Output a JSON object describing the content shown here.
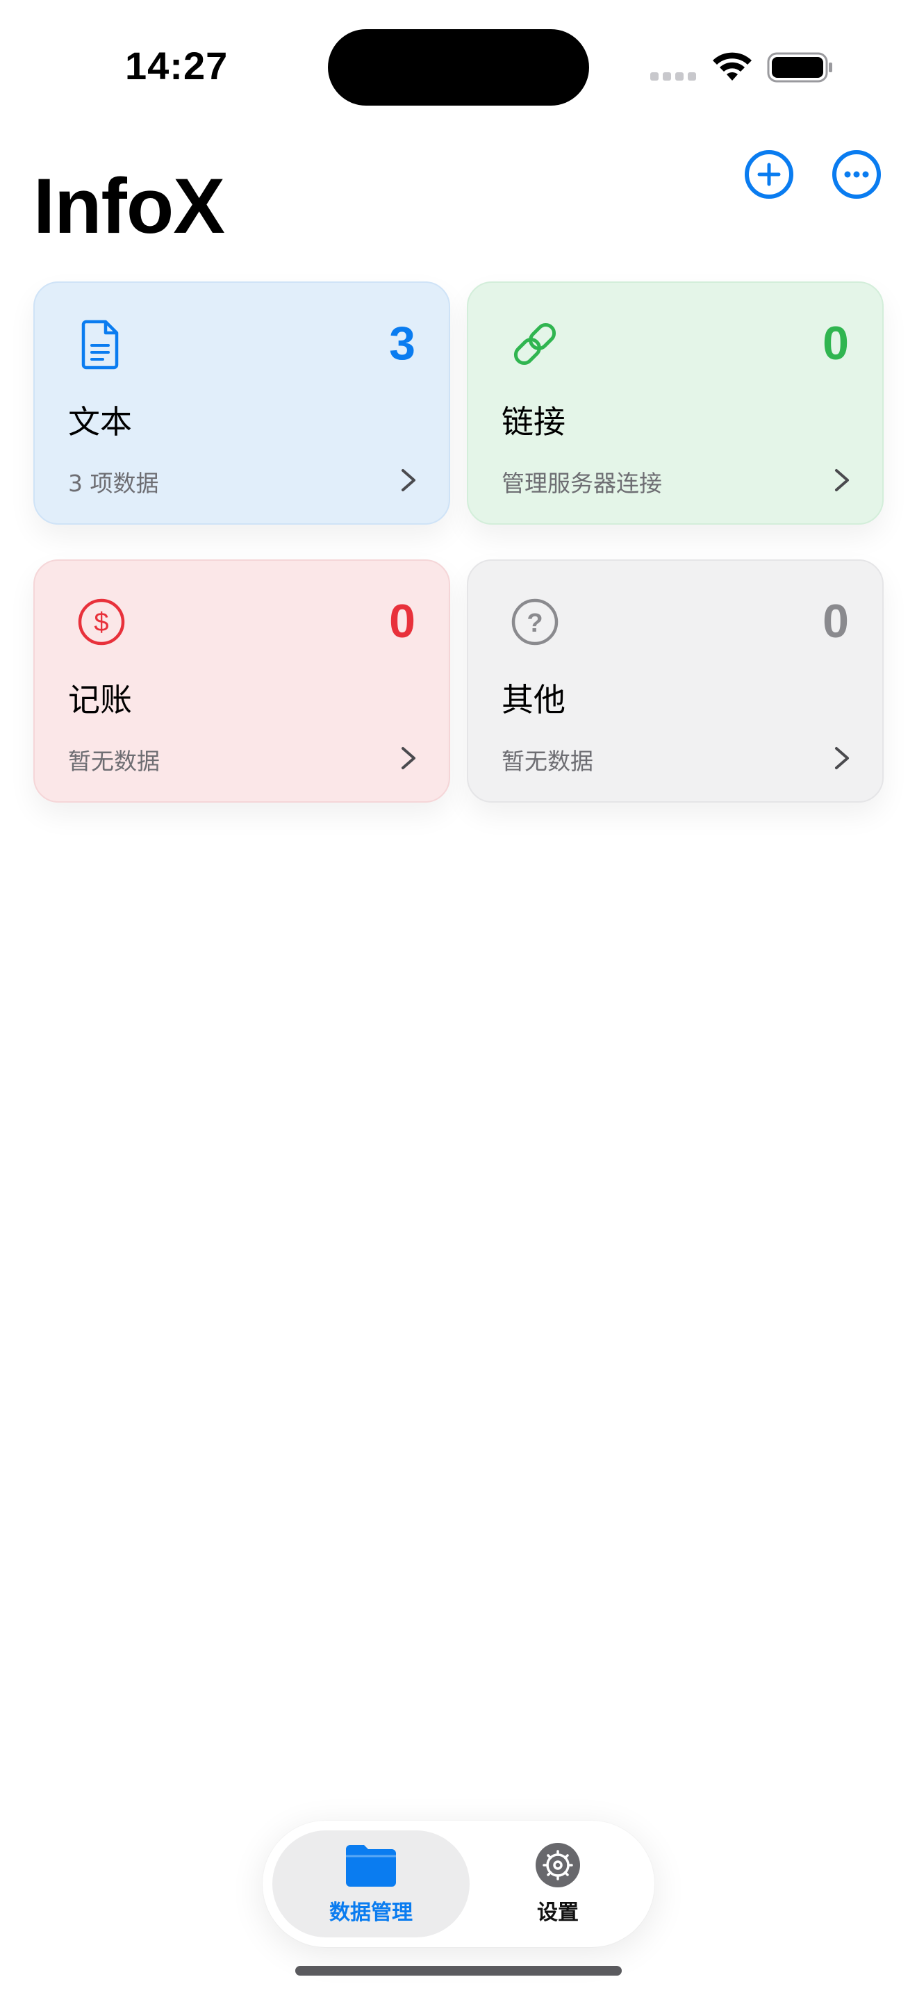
{
  "status_bar": {
    "time": "14:27"
  },
  "header": {
    "title": "InfoX",
    "add_icon": "plus-circle-icon",
    "more_icon": "ellipsis-circle-icon"
  },
  "cards": [
    {
      "key": "text",
      "icon": "document-icon",
      "count": "3",
      "title": "文本",
      "subtitle": "3 项数据",
      "color": "#0a7cf0",
      "background": "#e1eefa"
    },
    {
      "key": "link",
      "icon": "link-icon",
      "count": "0",
      "title": "链接",
      "subtitle": "管理服务器连接",
      "color": "#30b550",
      "background": "#e4f5e8"
    },
    {
      "key": "money",
      "icon": "dollar-circle-icon",
      "count": "0",
      "title": "记账",
      "subtitle": "暂无数据",
      "color": "#e8313b",
      "background": "#fbe7e8"
    },
    {
      "key": "other",
      "icon": "question-circle-icon",
      "count": "0",
      "title": "其他",
      "subtitle": "暂无数据",
      "color": "#8a8a8e",
      "background": "#f1f1f2"
    }
  ],
  "tab_bar": {
    "tabs": [
      {
        "label": "数据管理",
        "icon": "folder-icon",
        "selected": true
      },
      {
        "label": "设置",
        "icon": "gear-icon",
        "selected": false
      }
    ]
  },
  "colors": {
    "accent": "#0a7cf0"
  }
}
